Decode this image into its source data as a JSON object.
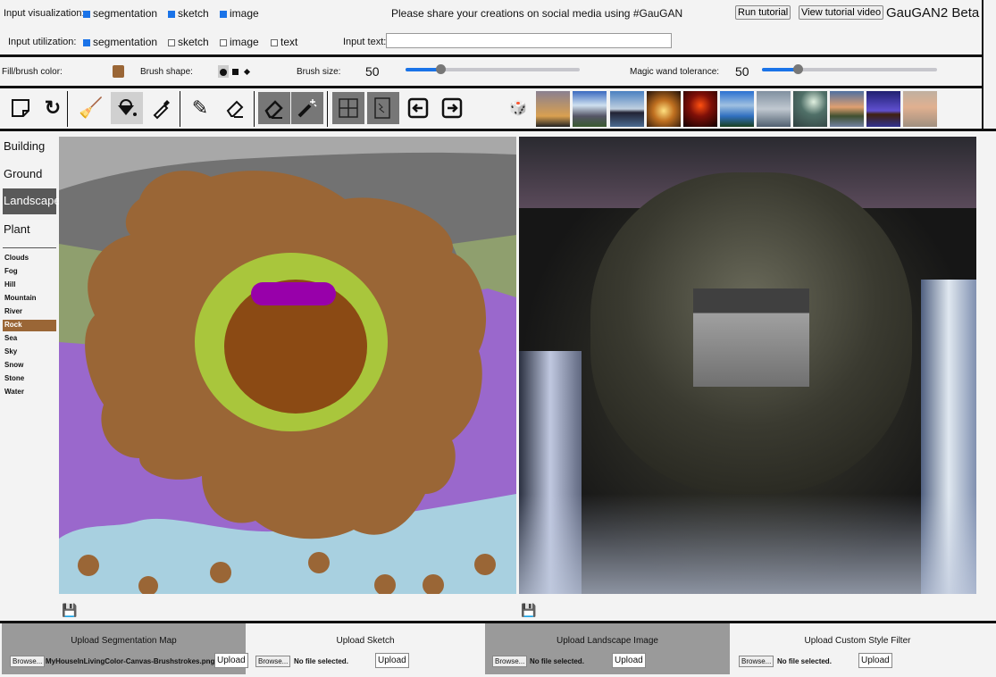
{
  "header": {
    "input_visualization_label": "Input visualization:",
    "input_visualization": [
      {
        "label": "segmentation",
        "checked": true
      },
      {
        "label": "sketch",
        "checked": true
      },
      {
        "label": "image",
        "checked": true
      }
    ],
    "input_utilization_label": "Input utilization:",
    "input_utilization": [
      {
        "label": "segmentation",
        "checked": true
      },
      {
        "label": "sketch",
        "checked": false
      },
      {
        "label": "image",
        "checked": false
      },
      {
        "label": "text",
        "checked": false
      }
    ],
    "share_message": "Please share your creations on social media using #GauGAN",
    "run_tutorial": "Run tutorial",
    "view_tutorial_video": "View tutorial video",
    "app_title": "GauGAN2 Beta",
    "input_text_label": "Input text:",
    "input_text_value": ""
  },
  "brush": {
    "fill_color_label": "Fill/brush color:",
    "fill_color": "#9a6636",
    "brush_shape_label": "Brush shape:",
    "shapes": [
      "circle",
      "square",
      "diamond"
    ],
    "selected_shape": "circle",
    "brush_size_label": "Brush size:",
    "brush_size": "50",
    "brush_size_fraction": 0.2,
    "magic_wand_label": "Magic wand tolerance:",
    "magic_wand": "50",
    "magic_wand_fraction": 0.2
  },
  "toolbar": {
    "tools": [
      "new-page",
      "redo",
      "clear-broom",
      "paint-bucket",
      "eyedropper",
      "pencil",
      "eraser",
      "eraser-filled",
      "magic-wand",
      "segmentation-puzzle",
      "sketch-notebook",
      "arrow-left",
      "arrow-right",
      "random-dice"
    ]
  },
  "sidebar": {
    "categories": [
      "Building",
      "Ground",
      "Landscape",
      "Plant"
    ],
    "selected_category": "Landscape",
    "labels": [
      "Clouds",
      "Fog",
      "Hill",
      "Mountain",
      "River",
      "Rock",
      "Sea",
      "Sky",
      "Snow",
      "Stone",
      "Water"
    ],
    "selected_label": "Rock"
  },
  "colors": {
    "sky": "#727272",
    "rock": "#9a6636",
    "hill": "#8f9f6e",
    "mountain": "#9a68cc",
    "water": "#a8d0e0",
    "grass": "#a9c63c",
    "house": "#8b4a14",
    "roof": "#9800aa"
  },
  "uploads": [
    {
      "title": "Upload Segmentation Map",
      "browse": "Browse...",
      "file": "MyHouseInLivingColor-Canvas-Brushstrokes.png",
      "upload": "Upload"
    },
    {
      "title": "Upload Sketch",
      "browse": "Browse...",
      "file": "No file selected.",
      "upload": "Upload"
    },
    {
      "title": "Upload Landscape Image",
      "browse": "Browse...",
      "file": "No file selected.",
      "upload": "Upload"
    },
    {
      "title": "Upload Custom Style Filter",
      "browse": "Browse...",
      "file": "No file selected.",
      "upload": "Upload"
    }
  ]
}
